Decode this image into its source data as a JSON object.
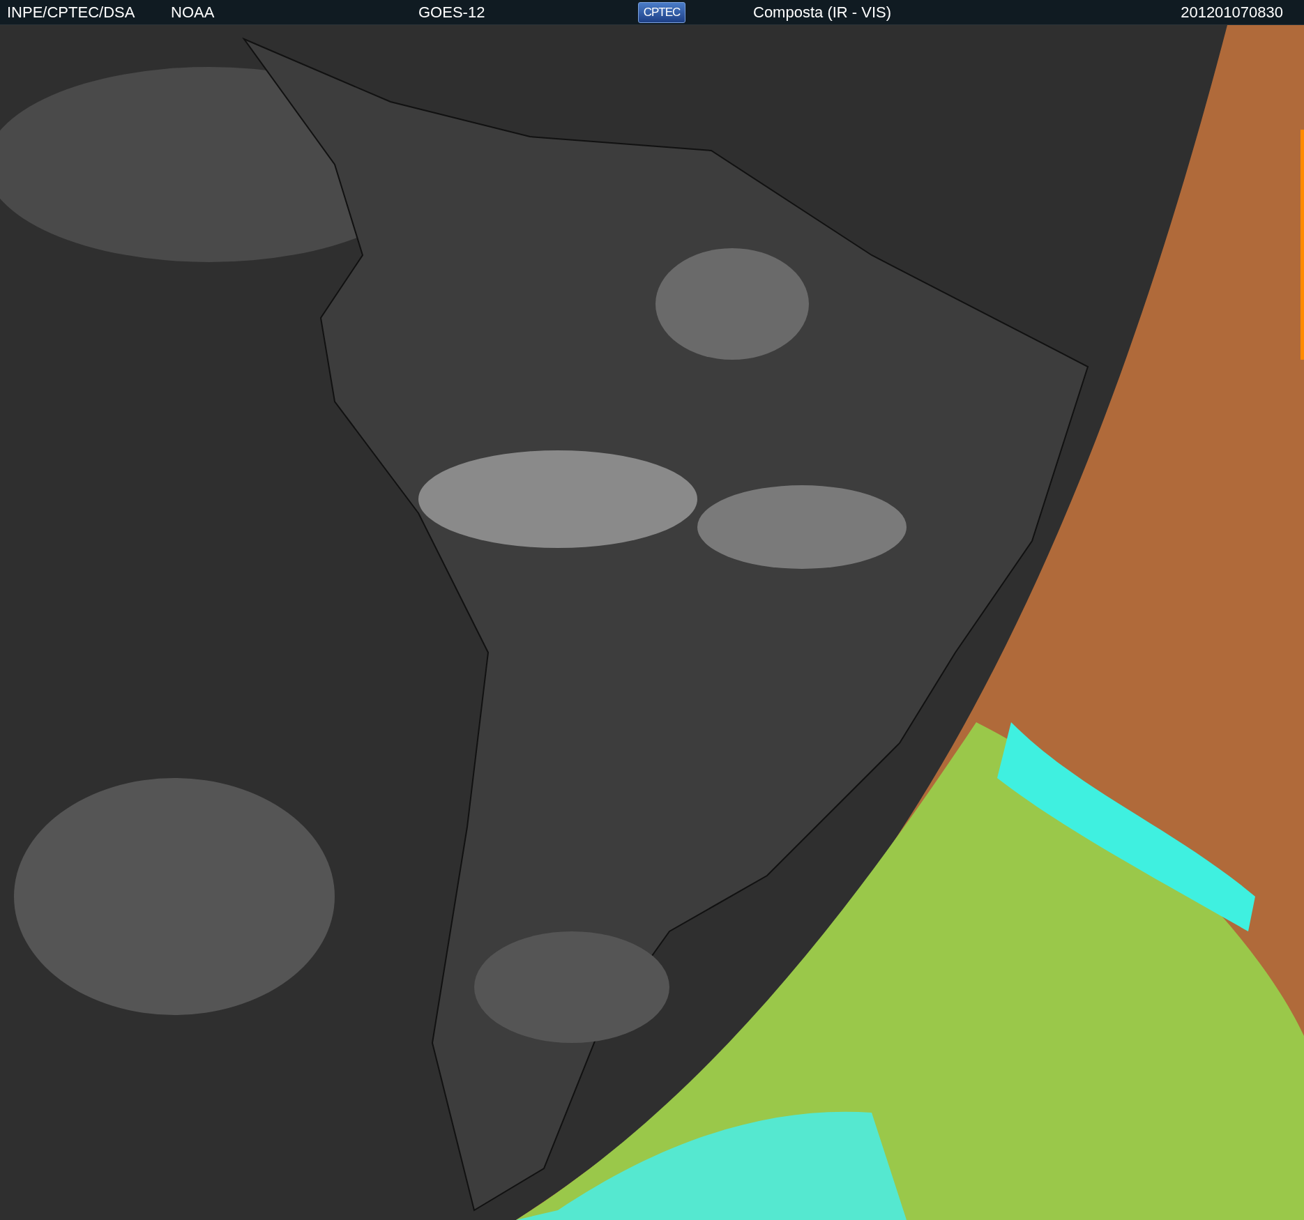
{
  "header": {
    "agency": "INPE/CPTEC/DSA",
    "source": "NOAA",
    "satellite": "GOES-12",
    "logo": "CPTEC",
    "product": "Composta (IR - VIS)",
    "timestamp": "201201070830"
  }
}
